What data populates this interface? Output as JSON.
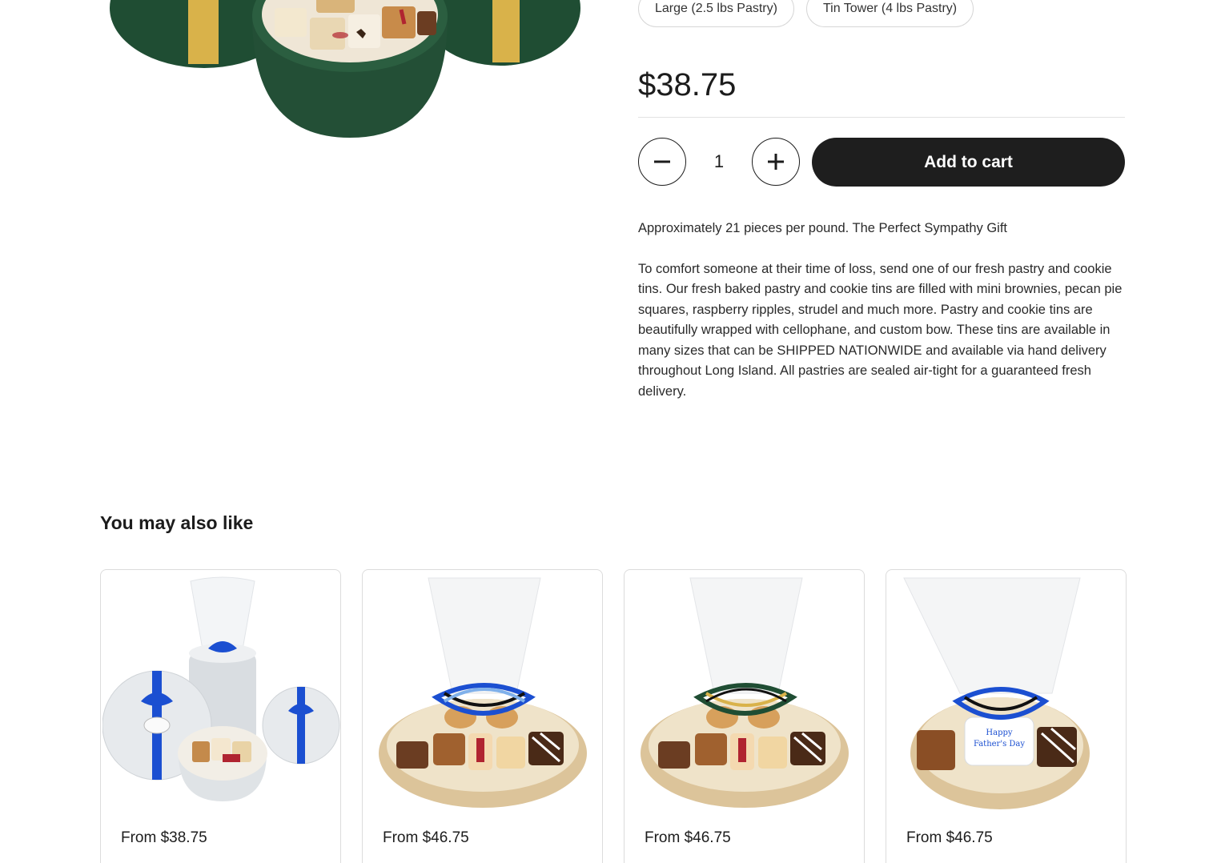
{
  "variants": [
    {
      "label": "Large (2.5 lbs Pastry)"
    },
    {
      "label": "Tin Tower (4 lbs Pastry)"
    }
  ],
  "product": {
    "price": "$38.75",
    "quantity": "1",
    "add_to_cart_label": "Add to cart",
    "description": [
      "Approximately 21 pieces per pound. The Perfect Sympathy Gift",
      "To comfort someone at their time of loss, send one of our fresh pastry and cookie tins. Our fresh baked pastry and cookie tins are filled with mini brownies, pecan pie squares, raspberry ripples, strudel and much more. Pastry and cookie tins are beautifully wrapped with cellophane, and custom bow. These tins are available in many sizes that can be SHIPPED NATIONWIDE and available via hand delivery throughout Long Island. All pastries are sealed air-tight for a guaranteed fresh delivery."
    ]
  },
  "related": {
    "title": "You may also like",
    "cards": [
      {
        "price": "From $38.75",
        "image": "silver-tin-tower-image"
      },
      {
        "price": "From $46.75",
        "image": "pastry-basket-blue-ribbon-image"
      },
      {
        "price": "From $46.75",
        "image": "pastry-basket-green-gold-ribbon-image"
      },
      {
        "price": "From $46.75",
        "image": "fathers-day-pastry-basket-image",
        "badge_lines": [
          "Happy",
          "Father's Day"
        ]
      }
    ]
  },
  "colors": {
    "tin_green": "#1f4d33",
    "ribbon_gold": "#d9b24a",
    "ribbon_blue": "#1b4fd1",
    "button_dark": "#1e1e1e"
  }
}
